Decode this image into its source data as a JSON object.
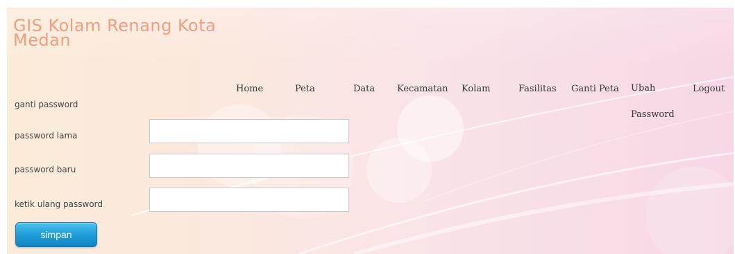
{
  "site": {
    "title": "GIS Kolam Renang Kota Medan"
  },
  "nav": {
    "home": "Home",
    "peta": "Peta",
    "data": "Data",
    "kecamatan": "Kecamatan",
    "kolam": "Kolam",
    "fasilitas": "Fasilitas",
    "ganti_peta": "Ganti Peta",
    "ubah_password": "Ubah Password",
    "logout": "Logout"
  },
  "form": {
    "heading": "ganti password",
    "old_password_label": "password lama",
    "new_password_label": "password baru",
    "confirm_password_label": "ketik ulang password",
    "old_password_value": "",
    "new_password_value": "",
    "confirm_password_value": "",
    "submit_label": "simpan"
  },
  "colors": {
    "title": "#ee9f82",
    "button": "#1f9ed9",
    "background_left": "#fbecd9",
    "background_right": "#f7d7e6"
  }
}
